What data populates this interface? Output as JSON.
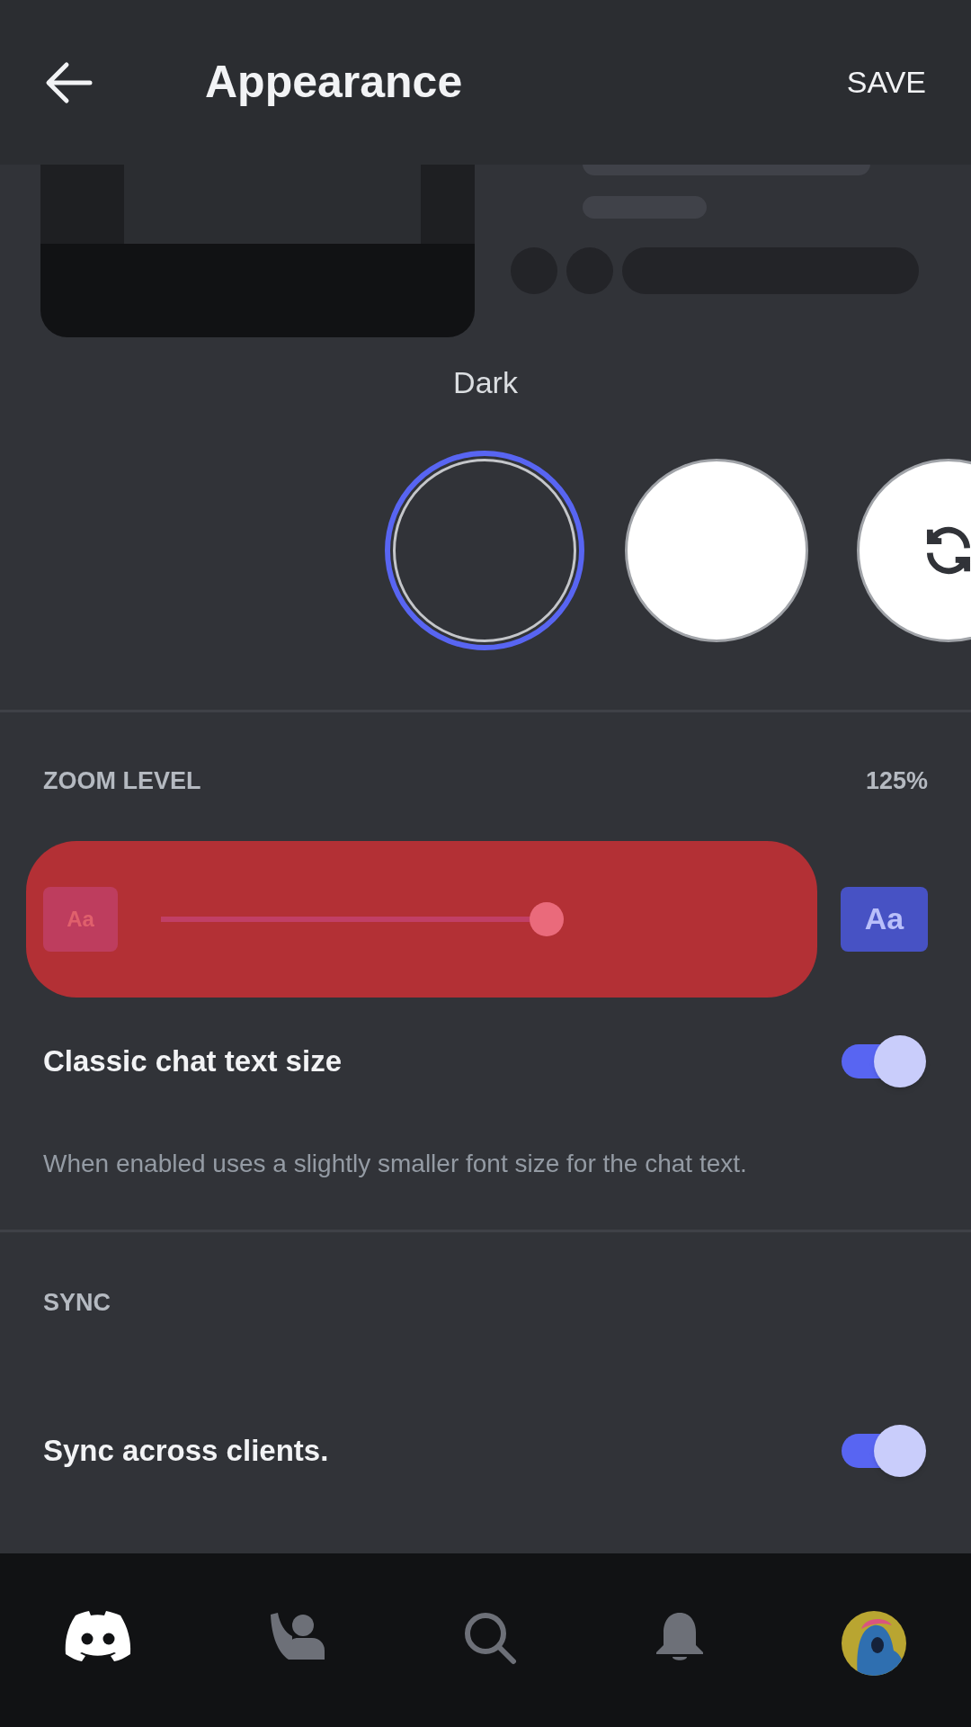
{
  "header": {
    "title": "Appearance",
    "action": "SAVE"
  },
  "theme": {
    "label": "Dark",
    "options": [
      {
        "kind": "dark",
        "selected": true
      },
      {
        "kind": "light",
        "selected": false
      },
      {
        "kind": "sync",
        "selected": false
      }
    ]
  },
  "zoom": {
    "label": "ZOOM LEVEL",
    "value": "125%",
    "level": 0.64,
    "small_sample": "Aa",
    "large_sample": "Aa"
  },
  "classic": {
    "label": "Classic chat text size",
    "on": true,
    "description": "When enabled uses a slightly smaller font size for the chat text."
  },
  "sync": {
    "heading": "SYNC",
    "label": "Sync across clients.",
    "on": true
  },
  "nav": [
    {
      "kind": "home",
      "selected": true
    },
    {
      "kind": "friends",
      "selected": false
    },
    {
      "kind": "search",
      "selected": false
    },
    {
      "kind": "notifications",
      "selected": false
    },
    {
      "kind": "profile",
      "selected": false
    }
  ]
}
